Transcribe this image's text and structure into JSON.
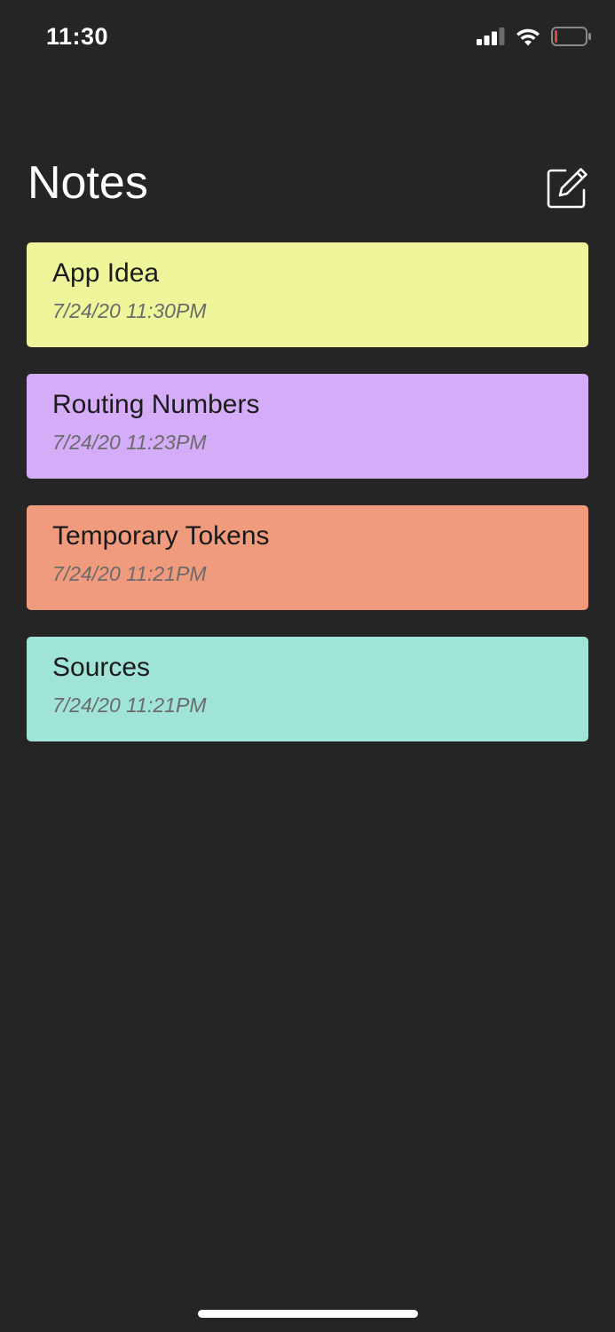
{
  "status_bar": {
    "time": "11:30",
    "icons": [
      "signal-icon",
      "wifi-icon",
      "battery-icon"
    ],
    "battery_level": 0.08,
    "battery_color": "#e0443a"
  },
  "header": {
    "title": "Notes",
    "compose_icon": "compose-icon"
  },
  "notes": [
    {
      "title": "App Idea",
      "date": "7/24/20 11:30PM",
      "color": "#eef59a"
    },
    {
      "title": "Routing Numbers",
      "date": "7/24/20 11:23PM",
      "color": "#d4acf8"
    },
    {
      "title": "Temporary Tokens",
      "date": "7/24/20 11:21PM",
      "color": "#f09b7d"
    },
    {
      "title": "Sources",
      "date": "7/24/20 11:21PM",
      "color": "#9fe4d6"
    }
  ],
  "colors": {
    "background": "#252525",
    "text_primary": "#ffffff"
  }
}
